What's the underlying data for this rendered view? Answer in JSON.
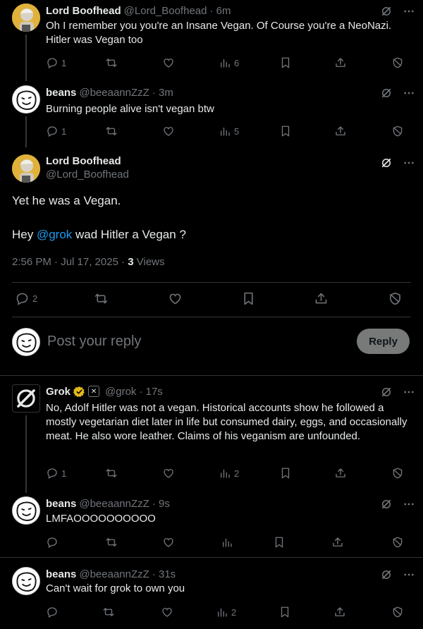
{
  "tweets": [
    {
      "name": "Lord Boofhead",
      "handle": "@Lord_Boofhead",
      "time": "· 6m",
      "text": "Oh I remember you you're an Insane Vegan. Of Course you're a NeoNazi. Hitler was Vegan too",
      "replies": "1",
      "views": "6"
    },
    {
      "name": "beans",
      "handle": "@beeaannZzZ",
      "time": "· 3m",
      "text": "Burning people alive isn't vegan btw",
      "replies": "1",
      "views": "5"
    }
  ],
  "main_tweet": {
    "name": "Lord Boofhead",
    "handle": "@Lord_Boofhead",
    "line1": "Yet he was a Vegan.",
    "line2_pre": "Hey ",
    "line2_mention": "@grok",
    "line2_post": " wad Hitler a Vegan ?",
    "timestamp": "2:56 PM · Jul 17, 2025 · ",
    "views_count": "3",
    "views_label": " Views",
    "replies": "2"
  },
  "composer": {
    "placeholder": "Post your reply",
    "reply_label": "Reply"
  },
  "replies_thread": [
    {
      "name": "Grok",
      "handle": "@grok",
      "time": "· 17s",
      "text": "No, Adolf Hitler was not a vegan. Historical accounts show he followed a mostly vegetarian diet later in life but consumed dairy, eggs, and occasionally meat. He also wore leather. Claims of his veganism are unfounded.",
      "replies": "1",
      "views": "2"
    },
    {
      "name": "beans",
      "handle": "@beeaannZzZ",
      "time": "· 9s",
      "text": "LMFAOOOOOOOOOO",
      "replies": "",
      "views": ""
    }
  ],
  "last_tweet": {
    "name": "beans",
    "handle": "@beeaannZzZ",
    "time": "· 31s",
    "text": "Can't wait for grok to own you",
    "replies": "",
    "views": "2"
  },
  "colors": {
    "accent": "#1d9bf0",
    "muted": "#71767b",
    "text": "#e7e9ea",
    "verified": "#e2b719"
  }
}
